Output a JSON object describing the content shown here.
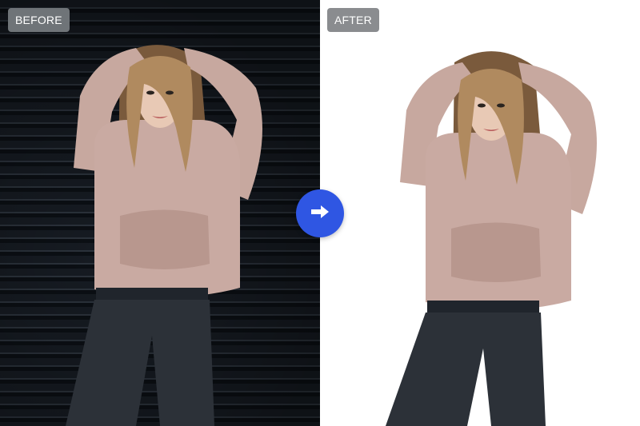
{
  "labels": {
    "before": "BEFORE",
    "after": "AFTER"
  },
  "icons": {
    "compare_arrow": "arrow-right-icon"
  },
  "colors": {
    "accent": "#2f56e3",
    "badge_before": "#6f7478",
    "badge_after": "#8a8c8f",
    "after_background": "#ffffff"
  }
}
